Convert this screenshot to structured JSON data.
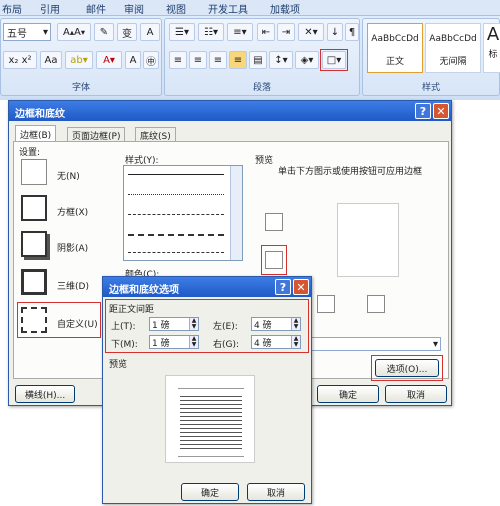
{
  "ribbon": {
    "tabs": [
      "布局",
      "引用",
      "邮件",
      "审阅",
      "视图",
      "开发工具",
      "加载项"
    ],
    "font_size": "五号",
    "group_font": "字体",
    "group_paragraph": "段落",
    "group_styles": "样式",
    "styles": [
      {
        "sample": "AaBbCcDd",
        "name": "正文"
      },
      {
        "sample": "AaBbCcDd",
        "name": "无间隔"
      },
      {
        "sample": "A",
        "name": "标"
      }
    ]
  },
  "main_dialog": {
    "title": "边框和底纹",
    "tabs": [
      "边框(B)",
      "页面边框(P)",
      "底纹(S)"
    ],
    "settings_label": "设置:",
    "settings": [
      "无(N)",
      "方框(X)",
      "阴影(A)",
      "三维(D)",
      "自定义(U)"
    ],
    "style_label": "样式(Y):",
    "color_label": "颜色(C):",
    "preview_label": "预览",
    "preview_hint": "单击下方图示或使用按钮可应用边框",
    "options_button": "选项(O)...",
    "horizontal_line_button": "横线(H)...",
    "ok_button": "确定",
    "cancel_button": "取消"
  },
  "options_dialog": {
    "title": "边框和底纹选项",
    "margin_label": "距正文间距",
    "top_label": "上(T):",
    "top_value": "1 磅",
    "left_label": "左(E):",
    "left_value": "4 磅",
    "bottom_label": "下(M):",
    "bottom_value": "1 磅",
    "right_label": "右(G):",
    "right_value": "4 磅",
    "preview_label": "预览",
    "ok_button": "确定",
    "cancel_button": "取消"
  }
}
